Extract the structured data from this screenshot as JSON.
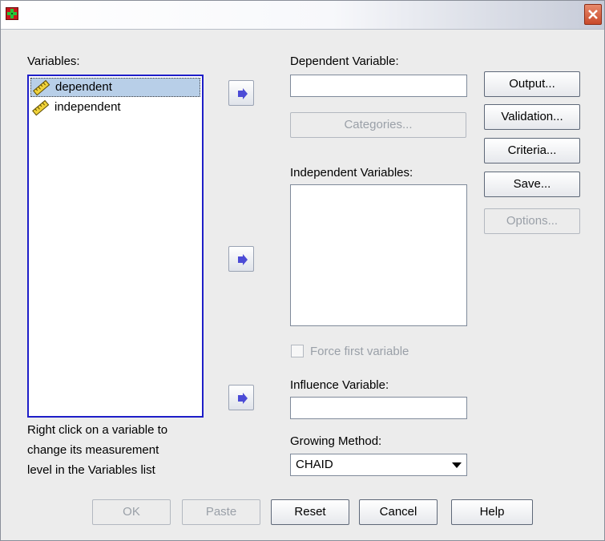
{
  "window": {
    "title": ""
  },
  "variables": {
    "label": "Variables:",
    "items": [
      {
        "name": "dependent",
        "icon": "scale-ruler-icon",
        "selected": true
      },
      {
        "name": "independent",
        "icon": "scale-ruler-icon",
        "selected": false
      }
    ],
    "hint_line1": "Right click on a variable to",
    "hint_line2": "change its measurement",
    "hint_line3": "level in the Variables list"
  },
  "dependent": {
    "label": "Dependent Variable:",
    "value": "",
    "categories_button": "Categories..."
  },
  "independent": {
    "label": "Independent Variables:",
    "force_first_label": "Force first variable",
    "force_first_checked": false
  },
  "influence": {
    "label": "Influence Variable:",
    "value": ""
  },
  "growing": {
    "label": "Growing Method:",
    "selected": "CHAID"
  },
  "side_buttons": {
    "output": "Output...",
    "validation": "Validation...",
    "criteria": "Criteria...",
    "save": "Save...",
    "options": "Options..."
  },
  "bottom_buttons": {
    "ok": "OK",
    "paste": "Paste",
    "reset": "Reset",
    "cancel": "Cancel",
    "help": "Help"
  },
  "colors": {
    "accent": "#1e1ec8",
    "selection": "#b8cfe8",
    "arrow": "#4b4bd6"
  }
}
